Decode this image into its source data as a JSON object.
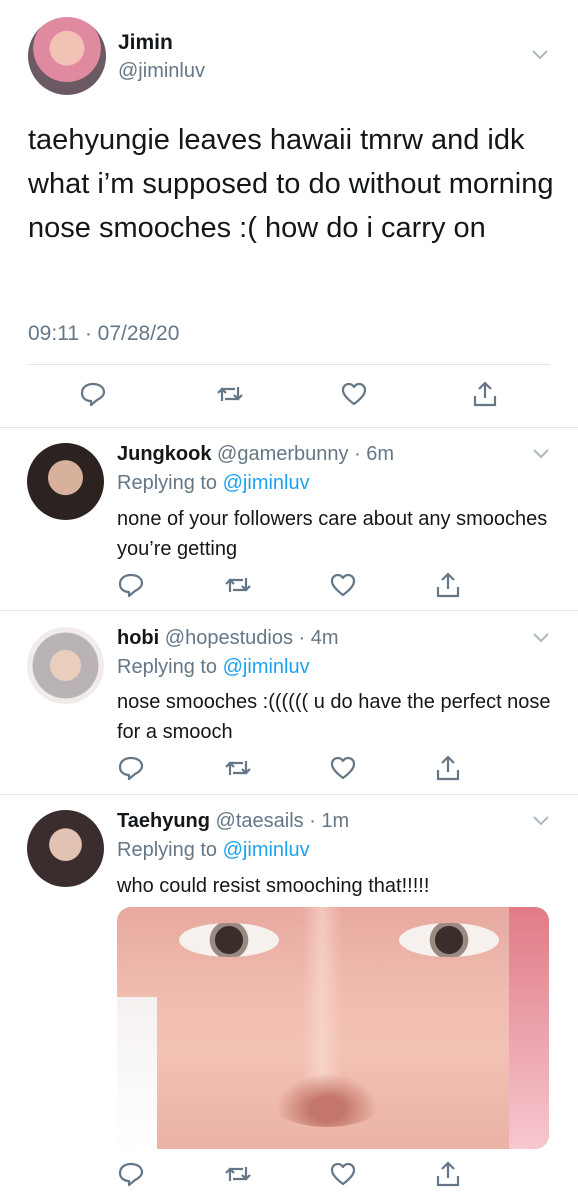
{
  "main": {
    "name": "Jimin",
    "handle": "@jiminluv",
    "text": "taehyungie leaves hawaii tmrw and idk what i’m supposed to do without morning nose smooches :( how do i carry on",
    "time": "09:11 · 07/28/20"
  },
  "replies": [
    {
      "name": "Jungkook",
      "handle": "@gamerbunny",
      "age": "· 6m",
      "replying_label": "Replying to",
      "replying_to": "@jiminluv",
      "text": "none of your followers care about any smooches you’re getting"
    },
    {
      "name": "hobi",
      "handle": "@hopestudios",
      "age": "· 4m",
      "replying_label": "Replying to",
      "replying_to": "@jiminluv",
      "text": "nose smooches :(((((( u do have the perfect nose for a smooch"
    },
    {
      "name": "Taehyung",
      "handle": "@taesails",
      "age": "· 1m",
      "replying_label": "Replying to",
      "replying_to": "@jiminluv",
      "text": "who could resist smooching that!!!!!"
    }
  ],
  "icons": {
    "reply": "reply-icon",
    "retweet": "retweet-icon",
    "like": "heart-icon",
    "share": "share-icon",
    "menu": "chevron-down-icon"
  },
  "colors": {
    "text": "#14171a",
    "muted": "#657786",
    "link": "#1da1f2",
    "divider": "#e1e8ed"
  }
}
